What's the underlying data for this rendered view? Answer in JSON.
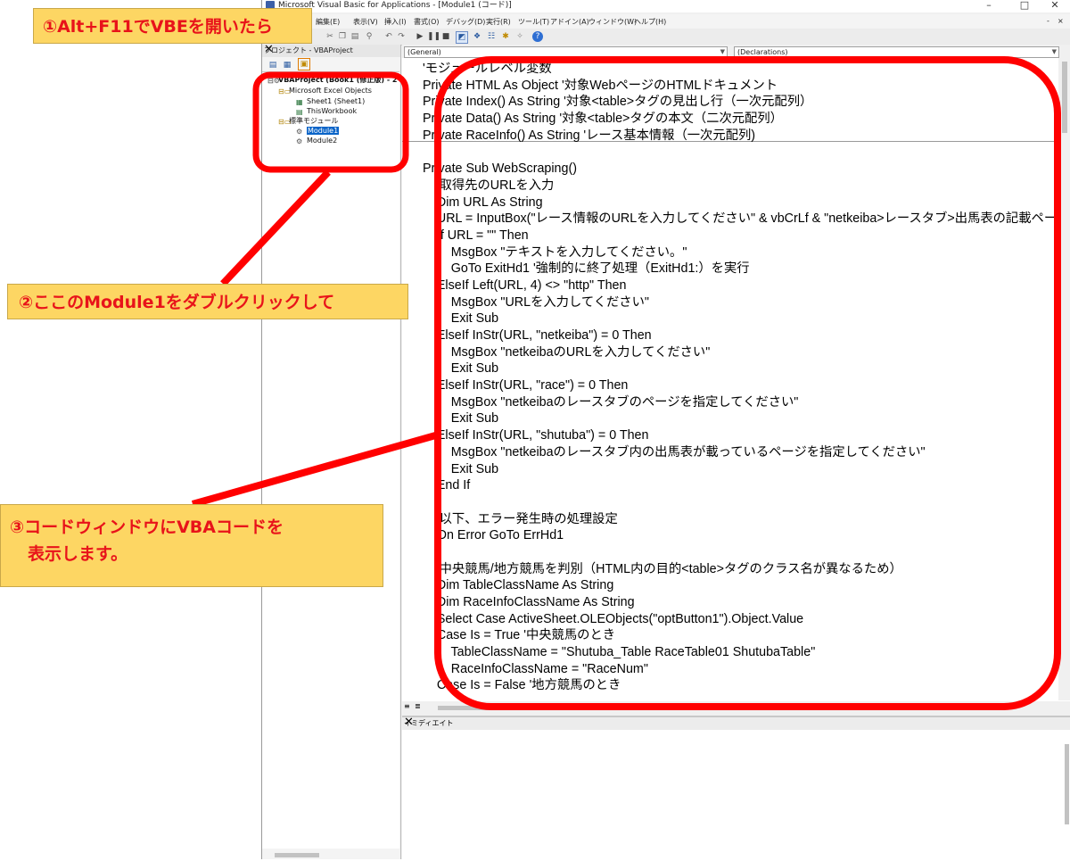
{
  "window": {
    "title": "Microsoft Visual Basic for Applications - [Module1 (コード)]",
    "controls": {
      "minimize": "–",
      "maximize": "□",
      "close": "✕",
      "inner_min": "-",
      "inner_restore": "ｇ",
      "inner_close": "×"
    }
  },
  "menu": {
    "items": [
      "編集(E)",
      "表示(V)",
      "挿入(I)",
      "書式(O)",
      "デバッグ(D)",
      "実行(R)",
      "ツール(T)",
      "アドイン(A)",
      "ウィンドウ(W)",
      "ヘルプ(H)"
    ]
  },
  "toolbar": {
    "icons": [
      "cut-icon",
      "copy-icon",
      "paste-icon",
      "find-icon",
      "undo-icon",
      "redo-icon",
      "run-icon",
      "break-icon",
      "reset-icon",
      "design-mode-icon",
      "project-explorer-icon",
      "properties-icon",
      "object-browser-icon",
      "toolbox-icon",
      "help-icon"
    ]
  },
  "project_explorer": {
    "title": "プロジェクト - VBAProject",
    "close": "✕",
    "tree": [
      {
        "label": "VBAProject (Book1 (修正版) - 2",
        "level": 0
      },
      {
        "label": "Microsoft Excel Objects",
        "level": 1
      },
      {
        "label": "Sheet1 (Sheet1)",
        "level": 2
      },
      {
        "label": "ThisWorkbook",
        "level": 2
      },
      {
        "label": "標準モジュール",
        "level": 1
      },
      {
        "label": "Module1",
        "level": 2,
        "selected": true
      },
      {
        "label": "Module2",
        "level": 2
      }
    ]
  },
  "code_window": {
    "object_combo": "(General)",
    "procedure_combo": "(Declarations)",
    "lines": [
      "'モジュールレベル変数",
      "Private HTML As Object '対象WebページのHTMLドキュメント",
      "Private Index() As String '対象<table>タグの見出し行（一次元配列）",
      "Private Data() As String '対象<table>タグの本文（二次元配列）",
      "Private RaceInfo() As String 'レース基本情報（一次元配列)",
      "",
      "Private Sub WebScraping()",
      "    '取得先のURLを入力",
      "    Dim URL As String",
      "    URL = InputBox(\"レース情報のURLを入力してください\" & vbCrLf & \"netkeiba>レースタブ>出馬表の記載ペー",
      "    If URL = \"\" Then",
      "        MsgBox \"テキストを入力してください。\"",
      "        GoTo ExitHd1 '強制的に終了処理（ExitHd1:）を実行",
      "    ElseIf Left(URL, 4) <> \"http\" Then",
      "        MsgBox \"URLを入力してください\"",
      "        Exit Sub",
      "    ElseIf InStr(URL, \"netkeiba\") = 0 Then",
      "        MsgBox \"netkeibaのURLを入力してください\"",
      "        Exit Sub",
      "    ElseIf InStr(URL, \"race\") = 0 Then",
      "        MsgBox \"netkeibaのレースタブのページを指定してください\"",
      "        Exit Sub",
      "    ElseIf InStr(URL, \"shutuba\") = 0 Then",
      "        MsgBox \"netkeibaのレースタブ内の出馬表が載っているページを指定してください\"",
      "        Exit Sub",
      "    End If",
      "",
      "    '以下、エラー発生時の処理設定",
      "    On Error GoTo ErrHd1",
      "",
      "    '中央競馬/地方競馬を判別（HTML内の目的<table>タグのクラス名が異なるため）",
      "    Dim TableClassName As String",
      "    Dim RaceInfoClassName As String",
      "    Select Case ActiveSheet.OLEObjects(\"optButton1\").Object.Value",
      "    Case Is = True '中央競馬のとき",
      "        TableClassName = \"Shutuba_Table RaceTable01 ShutubaTable\"",
      "        RaceInfoClassName = \"RaceNum\"",
      "    Case Is = False '地方競馬のとき"
    ]
  },
  "immediate_window": {
    "title": "イミディエイト",
    "close": "✕"
  },
  "callouts": {
    "step1": "①Alt+F11でVBEを開いたら",
    "step2": "②ここのModule1をダブルクリックして",
    "step3_line1": "③コードウィンドウにVBAコードを",
    "step3_line2": "表示します。"
  },
  "colors": {
    "highlight_red": "#ff0000",
    "callout_bg": "#fdd663",
    "callout_text": "#e8131a",
    "selection_blue": "#0a64c8"
  }
}
